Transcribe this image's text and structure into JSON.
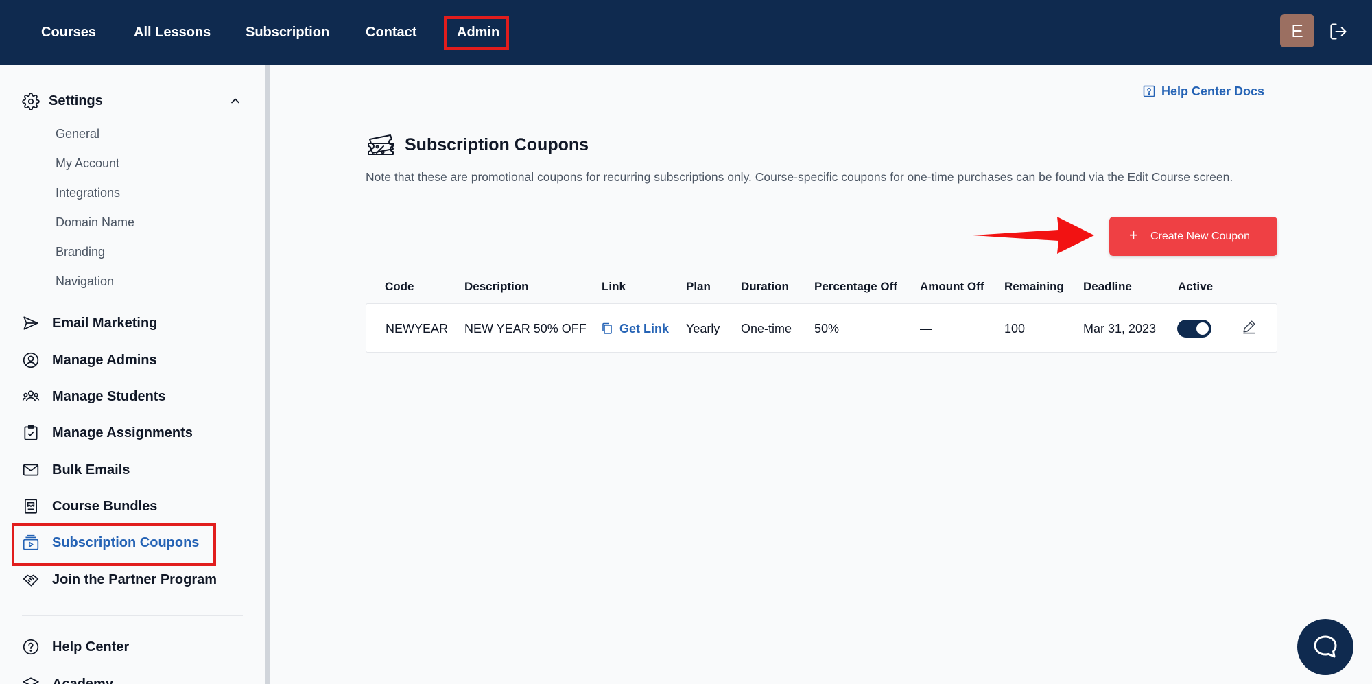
{
  "nav": {
    "items": [
      "Courses",
      "All Lessons",
      "Subscription",
      "Contact",
      "Admin"
    ],
    "avatar_letter": "E"
  },
  "sidebar": {
    "settings_label": "Settings",
    "settings_items": [
      "General",
      "My Account",
      "Integrations",
      "Domain Name",
      "Branding",
      "Navigation"
    ],
    "items": [
      {
        "label": "Email Marketing",
        "icon": "send-icon"
      },
      {
        "label": "Manage Admins",
        "icon": "user-circle-icon"
      },
      {
        "label": "Manage Students",
        "icon": "users-icon"
      },
      {
        "label": "Manage Assignments",
        "icon": "clipboard-check-icon"
      },
      {
        "label": "Bulk Emails",
        "icon": "mail-icon"
      },
      {
        "label": "Course Bundles",
        "icon": "bundle-icon"
      },
      {
        "label": "Subscription Coupons",
        "icon": "coupon-icon"
      },
      {
        "label": "Join the Partner Program",
        "icon": "handshake-icon"
      }
    ],
    "footer_items": [
      {
        "label": "Help Center",
        "icon": "help-circle-icon"
      },
      {
        "label": "Academy",
        "icon": "academy-icon"
      }
    ]
  },
  "main": {
    "help_docs_label": "Help Center Docs",
    "title": "Subscription Coupons",
    "note": "Note that these are promotional coupons for recurring subscriptions only. Course-specific coupons for one-time purchases can be found via the Edit Course screen.",
    "create_button_label": "Create New Coupon",
    "table": {
      "headers": [
        "Code",
        "Description",
        "Link",
        "Plan",
        "Duration",
        "Percentage Off",
        "Amount Off",
        "Remaining",
        "Deadline",
        "Active"
      ],
      "rows": [
        {
          "code": "NEWYEAR",
          "description": "NEW YEAR 50% OFF",
          "link_label": "Get Link",
          "plan": "Yearly",
          "duration": "One-time",
          "percentage_off": "50%",
          "amount_off": "—",
          "remaining": "100",
          "deadline": "Mar 31, 2023",
          "active": true
        }
      ]
    }
  },
  "colors": {
    "navbar": "#0f2a4f",
    "accent_link": "#2563b5",
    "create_button": "#ef4044",
    "highlight_box": "#e11d1d"
  }
}
